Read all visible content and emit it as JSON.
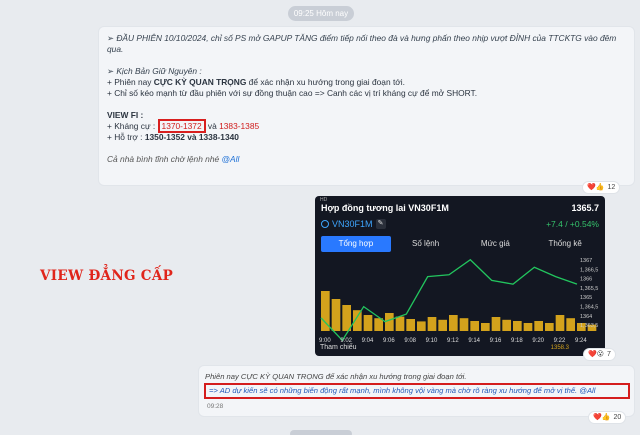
{
  "top_time": "09:25 Hôm nay",
  "message1": {
    "line1": "➢ ĐẦU PHIÊN 10/10/2024, chỉ số PS mở GAPUP TĂNG điểm tiếp nối theo đà và hưng phấn theo nhịp vượt ĐỈNH của TTCKTG vào đêm",
    "line1b": "qua.",
    "scenario_title": "➢ Kịch Bản Giữ Nguyên :",
    "b1_prefix": "+ Phiên nay ",
    "b1_bold": "CỰC KỲ QUAN TRỌNG",
    "b1_suffix": " để xác nhận xu hướng trong giai đoạn tới.",
    "b2": "+ Chỉ số kéo mạnh từ đầu phiên với sự đồng thuận cao => Canh các vị trí kháng cự để mở SHORT.",
    "view_title": "VIEW FI :",
    "res_label": "+ Kháng cự :",
    "res1": "1370-1372",
    "res_and": " và ",
    "res2": "1383-1385",
    "sup_label": "+ Hỗ trợ     :",
    "sup": "1350-1352 và 1338-1340",
    "outro": "Cả nhà bình tĩnh chờ lệnh nhé ",
    "mention": "@All",
    "reactions": {
      "emojis": "❤️👍",
      "count": "12"
    }
  },
  "chart_card": {
    "hd": "HD",
    "title": "Hợp đồng tương lai VN30F1M",
    "price": "1365.7",
    "symbol": "VN30F1M",
    "change": "+7.4 / +0.54%",
    "tabs": [
      "Tổng hợp",
      "Số lệnh",
      "Mức giá",
      "Thống kê"
    ],
    "footer_label": "Tham chiếu",
    "footer_value": "1358.3",
    "reactions": {
      "emojis": "❤️😮",
      "count": "7"
    }
  },
  "chart_data": {
    "type": "line",
    "x": [
      "9:00",
      "9:02",
      "9:04",
      "9:06",
      "9:08",
      "9:10",
      "9:12",
      "9:14",
      "9:16",
      "9:18",
      "9:20",
      "9:22",
      "9:24"
    ],
    "price_series": [
      1364.0,
      1362.8,
      1364.6,
      1363.8,
      1364.2,
      1366.2,
      1366.3,
      1367.1,
      1366.0,
      1365.8,
      1366.7,
      1366.2,
      1365.8
    ],
    "volume_series": [
      10,
      6.5,
      4,
      4.5,
      3,
      3.5,
      4,
      2.5,
      3.5,
      2.5,
      2.5,
      4,
      2
    ],
    "y_ticks": [
      1367,
      "1,366,5",
      1366,
      "1,365,5",
      1365,
      "1,364,5",
      1364,
      "1,363,5"
    ],
    "ylim": [
      1363.3,
      1367.3
    ],
    "line_color": "#22c55e",
    "bar_color": "#d3a21c"
  },
  "side_label": "VIEW ĐẲNG CẤP",
  "message2": {
    "quote1": "Phiên nay CỰC KỲ QUAN TRỌNG để xác nhận xu hướng trong giai đoạn tới.",
    "quote2": "=> AD dự kiến sẽ có những biến động rất mạnh, mình không vội vàng mà chờ rõ ràng xu hướng để mở vị thế. @All",
    "time": "09:28",
    "reactions": {
      "emojis": "❤️👍",
      "count": "20"
    }
  }
}
